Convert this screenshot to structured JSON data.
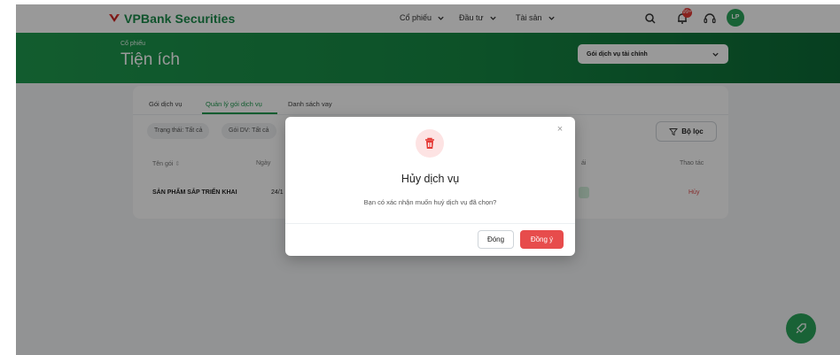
{
  "brand": {
    "name": "VPBank Securities",
    "color": "#1a8a4a",
    "accent_red": "#e53935"
  },
  "topnav": {
    "items": [
      {
        "label": "Cổ phiếu"
      },
      {
        "label": "Đầu tư"
      },
      {
        "label": "Tài sản"
      }
    ],
    "notification_badge": "99+",
    "avatar_initials": "LP",
    "icons": [
      "search-icon",
      "bell-icon",
      "headset-icon"
    ]
  },
  "header": {
    "breadcrumb": "Cổ phiếu",
    "title": "Tiện ích",
    "select_value": "Gói dịch vụ tài chính"
  },
  "card": {
    "tabs": [
      {
        "label": "Gói dịch vụ",
        "active": false
      },
      {
        "label": "Quản lý gói dịch vụ",
        "active": true
      },
      {
        "label": "Danh sách vay",
        "active": false
      }
    ],
    "chips": [
      "Trạng thái: Tất cả",
      "Gói DV: Tất cả"
    ],
    "filter_label": "Bộ lọc",
    "columns": {
      "name": "Tên gói",
      "date": "Ngày",
      "status": "ái",
      "action": "Thao tác"
    },
    "rows": [
      {
        "name": "SẢN PHẨM SẮP TRIỂN KHAI",
        "date": "24/1",
        "action": "Hủy"
      }
    ]
  },
  "modal": {
    "title": "Hủy dịch vụ",
    "message": "Bạn có xác nhận muốn huỷ dịch vụ đã chọn?",
    "cancel_label": "Đóng",
    "confirm_label": "Đồng ý"
  }
}
